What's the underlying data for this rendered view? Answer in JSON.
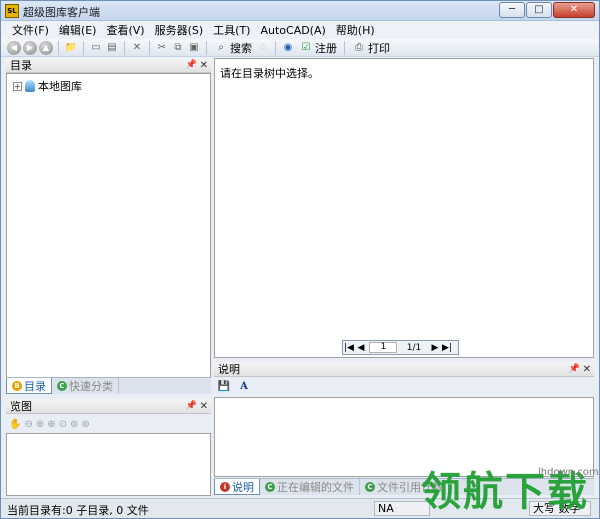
{
  "window": {
    "title": "超级图库客户端",
    "app_badge": "SL"
  },
  "window_buttons": {
    "minimize": "─",
    "maximize": "□",
    "close": "✕"
  },
  "menu": [
    "文件(F)",
    "编辑(E)",
    "查看(V)",
    "服务器(S)",
    "工具(T)",
    "AutoCAD(A)",
    "帮助(H)"
  ],
  "toolbar": {
    "search_label": "搜索",
    "register_label": "注册",
    "print_label": "打印"
  },
  "catalog_panel": {
    "title": "目录",
    "tree_root": "本地图库",
    "tabs": [
      "目录",
      "快速分类"
    ]
  },
  "preview_panel": {
    "title": "览图"
  },
  "main": {
    "hint": "请在目录树中选择。"
  },
  "pager": {
    "page_input": "1",
    "page_count": "1/1"
  },
  "description_panel": {
    "title": "说明",
    "tabs": [
      "说明",
      "正在编辑的文件",
      "文件引用计数"
    ]
  },
  "status": {
    "left_text": "当前目录有:0 子目录, 0 文件",
    "cell_na": "NA",
    "cell_extra": "大写 数字"
  },
  "watermark": {
    "text": "领航下载",
    "url": "lhdown.com"
  },
  "colors": {
    "accent": "#1a5dad",
    "watermark": "#1b9e2e"
  }
}
